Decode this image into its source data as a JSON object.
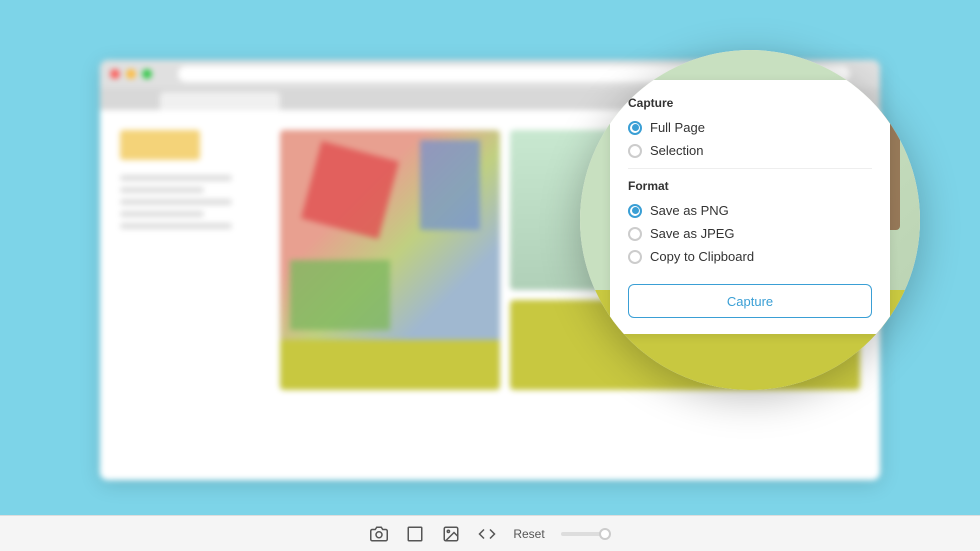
{
  "background": {
    "color": "#7dd4e8"
  },
  "browser": {
    "visible": true
  },
  "toolbar": {
    "reset_label": "Reset",
    "icons": [
      "camera",
      "crop",
      "image",
      "code"
    ]
  },
  "capture_panel": {
    "capture_section_title": "Capture",
    "format_section_title": "Format",
    "capture_button_label": "Capture",
    "options": {
      "capture": [
        {
          "label": "Full Page",
          "selected": true
        },
        {
          "label": "Selection",
          "selected": false
        }
      ],
      "format": [
        {
          "label": "Save as PNG",
          "selected": true
        },
        {
          "label": "Save as JPEG",
          "selected": false
        },
        {
          "label": "Copy to Clipboard",
          "selected": false
        }
      ]
    }
  }
}
